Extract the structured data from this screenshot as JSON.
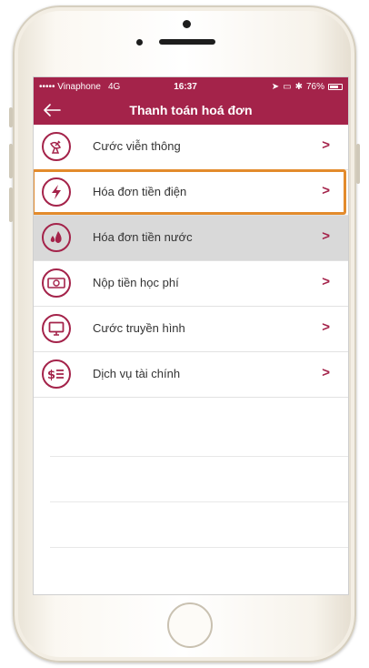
{
  "status_bar": {
    "carrier": "••••• Vinaphone",
    "network": "4G",
    "time": "16:37",
    "battery": "76%",
    "battery_level": 0.76
  },
  "nav": {
    "title": "Thanh toán hoá đơn",
    "back_icon": "arrow-left-icon"
  },
  "menu": {
    "items": [
      {
        "label": "Cước viễn thông",
        "icon": "satellite-dish-icon"
      },
      {
        "label": "Hóa đơn tiền điện",
        "icon": "lightning-icon"
      },
      {
        "label": "Hóa đơn tiền nước",
        "icon": "water-drops-icon",
        "selected": true
      },
      {
        "label": "Nộp tiền học phí",
        "icon": "banknote-icon"
      },
      {
        "label": "Cước truyền hình",
        "icon": "tv-monitor-icon"
      },
      {
        "label": "Dịch vụ tài chính",
        "icon": "dollar-list-icon"
      }
    ],
    "chevron": ">"
  },
  "colors": {
    "brand": "#a4234a",
    "highlight": "#e38b2c",
    "selected_row": "#d9d9d9"
  }
}
